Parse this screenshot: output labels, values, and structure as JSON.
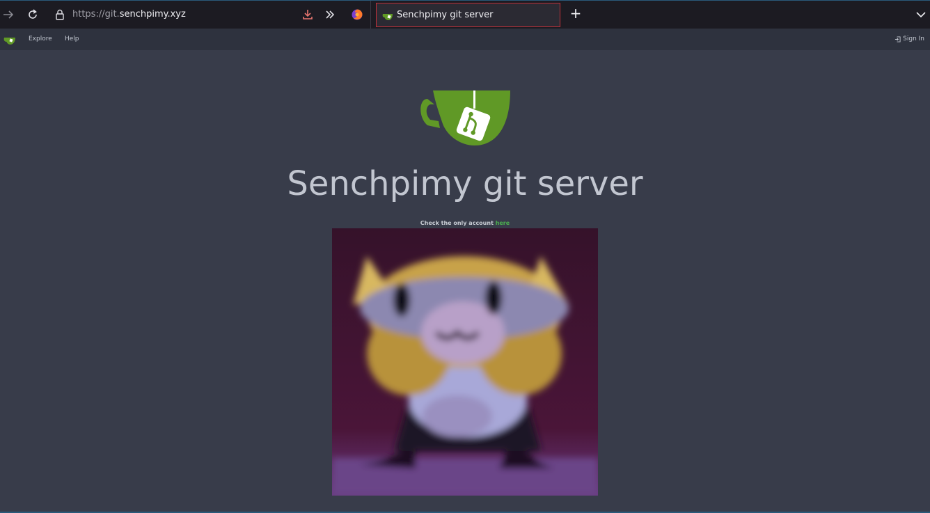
{
  "browser": {
    "url_prefix": "https://git.",
    "url_host": "senchpimy.xyz",
    "tab_title": "Senchpimy git server",
    "new_tab_label": "+"
  },
  "nav": {
    "explore": "Explore",
    "help": "Help",
    "sign_in": "Sign In"
  },
  "main": {
    "title": "Senchpimy git server",
    "subtext_prefix": "Check the only account ",
    "subtext_link": "here"
  },
  "colors": {
    "accent_green": "#609926",
    "link_green": "#4caf50",
    "background": "#383c4a"
  },
  "icons": [
    "forward-arrow-icon",
    "reload-icon",
    "lock-icon",
    "download-icon",
    "overflow-chevrons-icon",
    "firefox-icon",
    "gitea-tab-icon",
    "new-tab-icon",
    "tab-list-icon",
    "gitea-logo",
    "sign-in-icon"
  ]
}
